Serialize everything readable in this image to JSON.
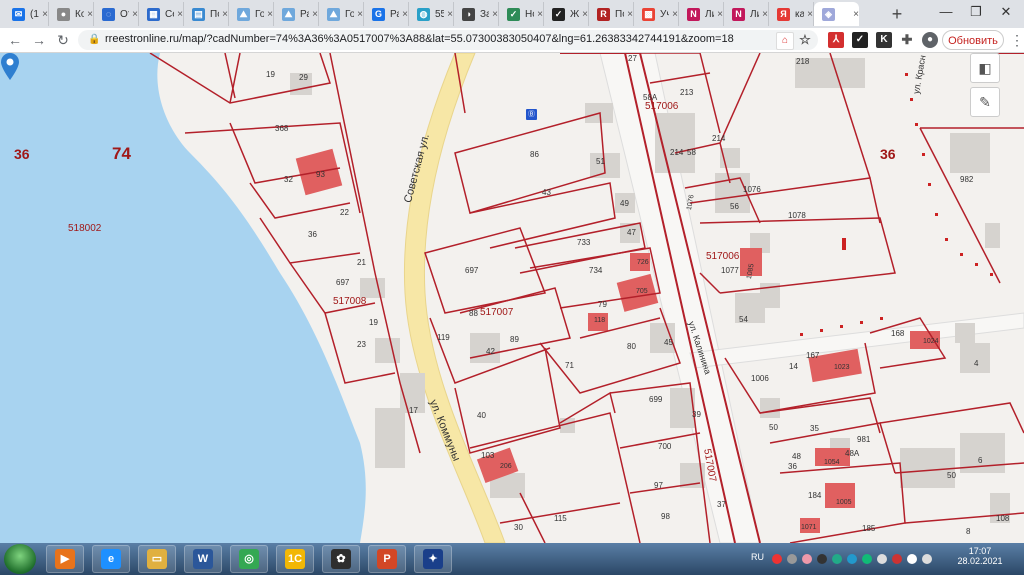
{
  "browser": {
    "tabs": [
      {
        "label": "(1) В",
        "color": "#1a73e8",
        "glyph": "✉"
      },
      {
        "label": "Кон",
        "color": "#888888",
        "glyph": "●"
      },
      {
        "label": "Отк",
        "color": "#2a6ad1",
        "glyph": "◌"
      },
      {
        "label": "Сет",
        "color": "#2d6bcc",
        "glyph": "▦"
      },
      {
        "label": "Пол",
        "color": "#3a8ad1",
        "glyph": "▤"
      },
      {
        "label": "Госу",
        "color": "#6fa8dc",
        "glyph": "⛰"
      },
      {
        "label": "Разд",
        "color": "#6fa8dc",
        "glyph": "⛰"
      },
      {
        "label": "Госу",
        "color": "#6fa8dc",
        "glyph": "⛰"
      },
      {
        "label": "Раз",
        "color": "#1a73e8",
        "glyph": "G"
      },
      {
        "label": "55 с",
        "color": "#2aa0c8",
        "glyph": "◍"
      },
      {
        "label": "Зая",
        "color": "#444444",
        "glyph": "◑"
      },
      {
        "label": "Нов",
        "color": "#2e8b57",
        "glyph": "✓"
      },
      {
        "label": "Жен",
        "color": "#222222",
        "glyph": "✓"
      },
      {
        "label": "Пол",
        "color": "#b22222",
        "glyph": "R"
      },
      {
        "label": "Уча",
        "color": "#ea4335",
        "glyph": "▩"
      },
      {
        "label": "Лич",
        "color": "#c2185b",
        "glyph": "N"
      },
      {
        "label": "Лич",
        "color": "#c2185b",
        "glyph": "N"
      },
      {
        "label": "кад",
        "color": "#e53935",
        "glyph": "Я"
      },
      {
        "label": "",
        "color": "#9fa8da",
        "glyph": "◈"
      }
    ],
    "new_tab_glyph": "+",
    "window_controls": {
      "minimize": "—",
      "maximize": "❐",
      "close": "✕"
    },
    "url": "rreestronline.ru/map/?cadNumber=74%3A36%3A0517007%3A88&lat=55.07300383050407&lng=61.26383342744191&zoom=18",
    "update_label": "Обновить",
    "nav": {
      "back": "←",
      "forward": "→",
      "reload": "↻"
    }
  },
  "map": {
    "big_labels": [
      {
        "text": "36"
      },
      {
        "text": "74"
      },
      {
        "text": "36"
      }
    ],
    "quarter_labels": [
      "518002",
      "517008",
      "517006",
      "517006",
      "517007",
      "517007"
    ],
    "parcels": [
      "19",
      "29",
      "368",
      "93",
      "32",
      "22",
      "36",
      "21",
      "697",
      "19",
      "23",
      "17",
      "86",
      "51",
      "43",
      "49",
      "733",
      "47",
      "697",
      "734",
      "726",
      "705",
      "79",
      "118",
      "88",
      "119",
      "89",
      "42",
      "71",
      "80",
      "45",
      "40",
      "699",
      "39",
      "700",
      "103",
      "206",
      "97",
      "98",
      "115",
      "37",
      "30",
      "213",
      "214",
      "58",
      "58А",
      "214",
      "1076",
      "56",
      "1076",
      "1078",
      "982",
      "1077",
      "1085",
      "54",
      "168",
      "1024",
      "167",
      "14",
      "1006",
      "1023",
      "4",
      "50",
      "48",
      "36",
      "35",
      "1054",
      "48А",
      "981",
      "6",
      "50",
      "184",
      "1005",
      "1071",
      "185",
      "108",
      "8",
      "218",
      "27"
    ],
    "streets": [
      "Советская ул.",
      "ул. Коммуны",
      "ул. Калинина",
      "ул. Красн",
      "517007"
    ],
    "selected_parcel": "517007",
    "bus_stop": "Ⓑ",
    "controls": {
      "layers": "◧",
      "ruler": "✎"
    }
  },
  "taskbar": {
    "language": "RU",
    "time": "17:07",
    "date": "28.02.2021",
    "apps": [
      {
        "glyph": "▶",
        "color": "#e8731a"
      },
      {
        "glyph": "e",
        "color": "#1e90ff"
      },
      {
        "glyph": "▭",
        "color": "#e0b040"
      },
      {
        "glyph": "W",
        "color": "#2b579a"
      },
      {
        "glyph": "◎",
        "color": "#34a853"
      },
      {
        "glyph": "1С",
        "color": "#f2b705"
      },
      {
        "glyph": "✿",
        "color": "#2e2e2e"
      },
      {
        "glyph": "P",
        "color": "#d24726"
      },
      {
        "glyph": "✦",
        "color": "#1a3f8a"
      }
    ]
  },
  "colors": {
    "parcel_line": "#b3202a",
    "water": "#a8d3f0",
    "road": "#f7e7a6",
    "building_red": "#e06060"
  }
}
